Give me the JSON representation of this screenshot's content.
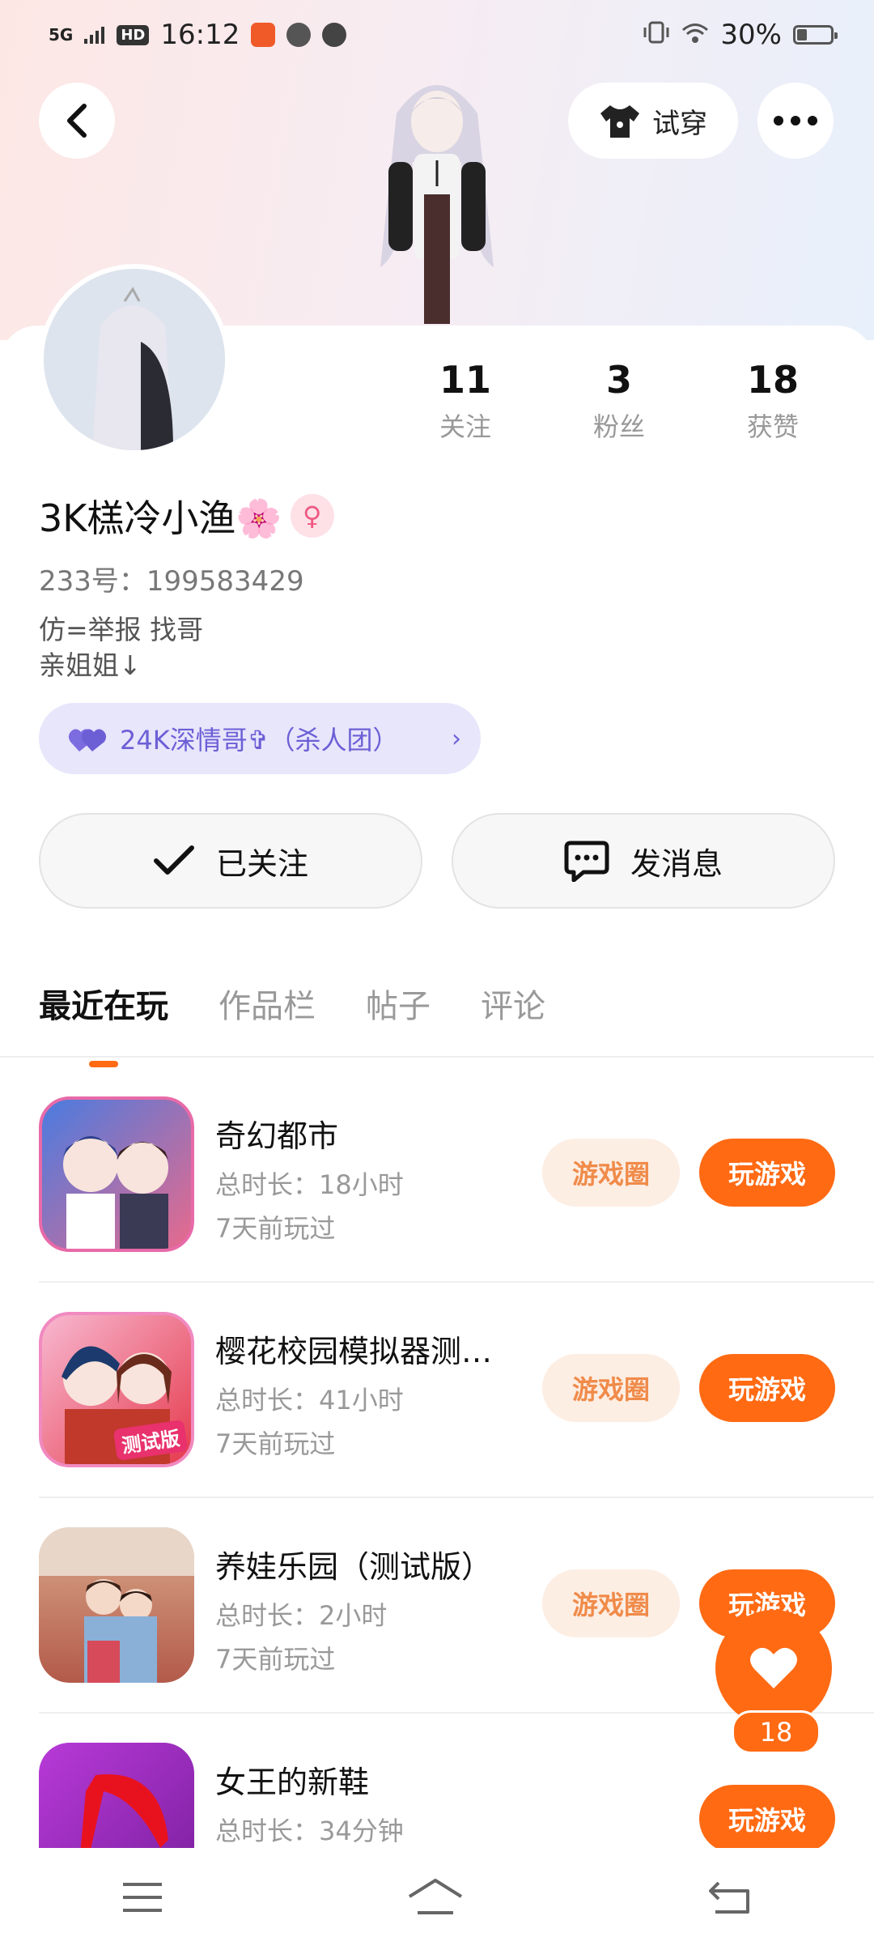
{
  "status_bar": {
    "network": "5G",
    "hd": "HD",
    "time": "16:12",
    "battery": "30%"
  },
  "header": {
    "try_on_label": "试穿"
  },
  "profile": {
    "stats": [
      {
        "num": "11",
        "label": "关注"
      },
      {
        "num": "3",
        "label": "粉丝"
      },
      {
        "num": "18",
        "label": "获赞"
      }
    ],
    "name": "3K榚冷小渔🌸",
    "gender_symbol": "♀",
    "uid": "233号：199583429",
    "bio_line1": "仿=举报 找哥",
    "bio_line2": "亲姐姐↓",
    "guild": "24K深情哥✞（杀人团）"
  },
  "actions": {
    "followed": "已关注",
    "message": "发消息"
  },
  "tabs": [
    "最近在玩",
    "作品栏",
    "帖子",
    "评论"
  ],
  "games": [
    {
      "title": "奇幻都市",
      "duration": "总时长：18小时",
      "last": "7天前玩过",
      "circle": "游戏圈",
      "play": "玩游戏"
    },
    {
      "title": "樱花校园模拟器测…",
      "duration": "总时长：41小时",
      "last": "7天前玩过",
      "circle": "游戏圈",
      "play": "玩游戏",
      "badge": "测试版"
    },
    {
      "title": "养娃乐园（测试版）",
      "duration": "总时长：2小时",
      "last": "7天前玩过",
      "circle": "游戏圈",
      "play": "玩游戏"
    },
    {
      "title": "女王的新鞋",
      "duration": "总时长：34分钟",
      "last": "",
      "circle": "",
      "play": "玩游戏"
    }
  ],
  "fab": {
    "count": "18"
  },
  "colors": {
    "accent": "#ff6a13",
    "guild_bg": "#e7e6fb",
    "guild_text": "#6c5fd6"
  }
}
